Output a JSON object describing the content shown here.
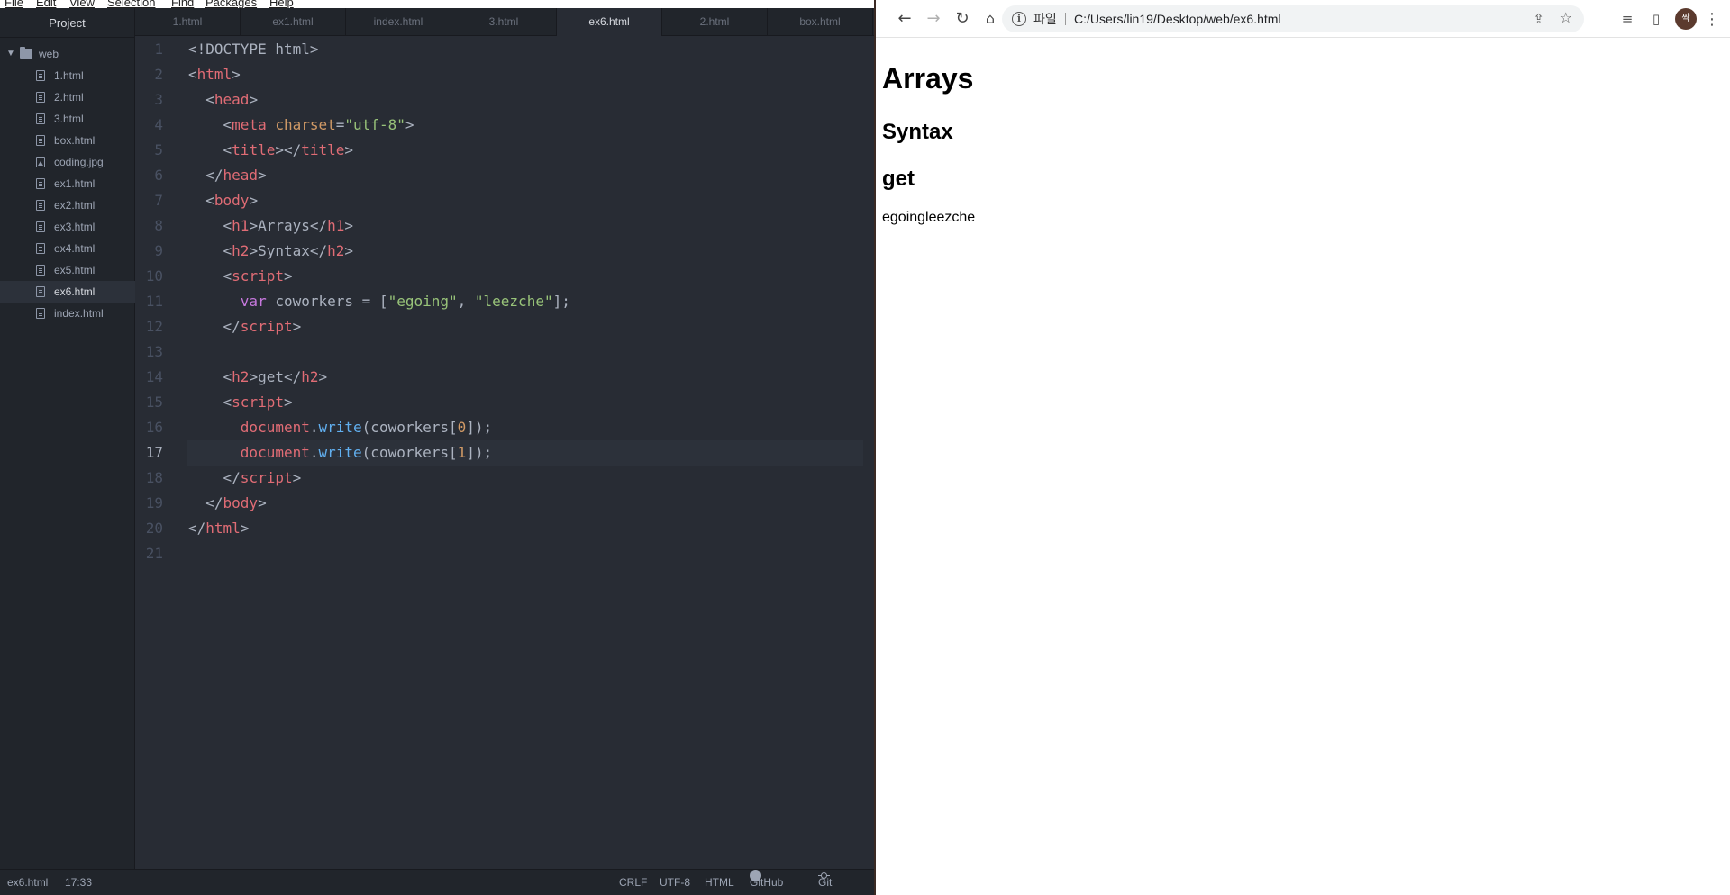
{
  "editor": {
    "menu": [
      "File",
      "Edit",
      "View",
      "Selection",
      "Find",
      "Packages",
      "Help"
    ],
    "tree": {
      "header": "Project",
      "folder": "web",
      "files": [
        {
          "name": "1.html",
          "type": "file"
        },
        {
          "name": "2.html",
          "type": "file"
        },
        {
          "name": "3.html",
          "type": "file"
        },
        {
          "name": "box.html",
          "type": "file"
        },
        {
          "name": "coding.jpg",
          "type": "image"
        },
        {
          "name": "ex1.html",
          "type": "file"
        },
        {
          "name": "ex2.html",
          "type": "file"
        },
        {
          "name": "ex3.html",
          "type": "file"
        },
        {
          "name": "ex4.html",
          "type": "file"
        },
        {
          "name": "ex5.html",
          "type": "file"
        },
        {
          "name": "ex6.html",
          "type": "file",
          "selected": true
        },
        {
          "name": "index.html",
          "type": "file"
        }
      ]
    },
    "tabs": [
      {
        "label": "1.html"
      },
      {
        "label": "ex1.html"
      },
      {
        "label": "index.html"
      },
      {
        "label": "3.html"
      },
      {
        "label": "ex6.html",
        "active": true
      },
      {
        "label": "2.html"
      },
      {
        "label": "box.html"
      }
    ],
    "current_line": 17,
    "code_lines": [
      [
        [
          "p",
          "<!DOCTYPE html>"
        ]
      ],
      [
        [
          "p",
          "<"
        ],
        [
          "t",
          "html"
        ],
        [
          "p",
          ">"
        ]
      ],
      [
        [
          "p",
          "  <"
        ],
        [
          "t",
          "head"
        ],
        [
          "p",
          ">"
        ]
      ],
      [
        [
          "p",
          "    <"
        ],
        [
          "t",
          "meta"
        ],
        [
          "p",
          " "
        ],
        [
          "a",
          "charset"
        ],
        [
          "p",
          "="
        ],
        [
          "s",
          "\"utf-8\""
        ],
        [
          "p",
          ">"
        ]
      ],
      [
        [
          "p",
          "    <"
        ],
        [
          "t",
          "title"
        ],
        [
          "p",
          "></"
        ],
        [
          "t",
          "title"
        ],
        [
          "p",
          ">"
        ]
      ],
      [
        [
          "p",
          "  </"
        ],
        [
          "t",
          "head"
        ],
        [
          "p",
          ">"
        ]
      ],
      [
        [
          "p",
          "  <"
        ],
        [
          "t",
          "body"
        ],
        [
          "p",
          ">"
        ]
      ],
      [
        [
          "p",
          "    <"
        ],
        [
          "t",
          "h1"
        ],
        [
          "p",
          ">Arrays</"
        ],
        [
          "t",
          "h1"
        ],
        [
          "p",
          ">"
        ]
      ],
      [
        [
          "p",
          "    <"
        ],
        [
          "t",
          "h2"
        ],
        [
          "p",
          ">Syntax</"
        ],
        [
          "t",
          "h2"
        ],
        [
          "p",
          ">"
        ]
      ],
      [
        [
          "p",
          "    <"
        ],
        [
          "t",
          "script"
        ],
        [
          "p",
          ">"
        ]
      ],
      [
        [
          "p",
          "      "
        ],
        [
          "k",
          "var"
        ],
        [
          "p",
          " coworkers = ["
        ],
        [
          "s",
          "\"egoing\""
        ],
        [
          "p",
          ", "
        ],
        [
          "s",
          "\"leezche\""
        ],
        [
          "p",
          "];"
        ]
      ],
      [
        [
          "p",
          "    </"
        ],
        [
          "t",
          "script"
        ],
        [
          "p",
          ">"
        ]
      ],
      [
        [
          "p",
          ""
        ]
      ],
      [
        [
          "p",
          "    <"
        ],
        [
          "t",
          "h2"
        ],
        [
          "p",
          ">get</"
        ],
        [
          "t",
          "h2"
        ],
        [
          "p",
          ">"
        ]
      ],
      [
        [
          "p",
          "    <"
        ],
        [
          "t",
          "script"
        ],
        [
          "p",
          ">"
        ]
      ],
      [
        [
          "p",
          "      "
        ],
        [
          "v",
          "document"
        ],
        [
          "p",
          "."
        ],
        [
          "f",
          "write"
        ],
        [
          "p",
          "(coworkers["
        ],
        [
          "n",
          "0"
        ],
        [
          "p",
          "]);"
        ]
      ],
      [
        [
          "p",
          "      "
        ],
        [
          "v",
          "document"
        ],
        [
          "p",
          "."
        ],
        [
          "f",
          "write"
        ],
        [
          "p",
          "(coworkers["
        ],
        [
          "n",
          "1"
        ],
        [
          "p",
          "]);"
        ]
      ],
      [
        [
          "p",
          "    </"
        ],
        [
          "t",
          "script"
        ],
        [
          "p",
          ">"
        ]
      ],
      [
        [
          "p",
          "  </"
        ],
        [
          "t",
          "body"
        ],
        [
          "p",
          ">"
        ]
      ],
      [
        [
          "p",
          "</"
        ],
        [
          "t",
          "html"
        ],
        [
          "p",
          ">"
        ]
      ],
      [
        [
          "p",
          ""
        ]
      ]
    ],
    "status": {
      "file": "ex6.html",
      "cursor": "17:33",
      "line_ending": "CRLF",
      "encoding": "UTF-8",
      "grammar": "HTML",
      "github": "GitHub",
      "git": "Git (0)"
    }
  },
  "browser": {
    "scheme_label": "파일",
    "url": "C:/Users/lin19/Desktop/web/ex6.html",
    "avatar_initial": "짝",
    "nav_icons": [
      "back-arrow-icon",
      "forward-arrow-icon",
      "reload-icon",
      "home-icon"
    ],
    "page": {
      "h1": "Arrays",
      "h2_syntax": "Syntax",
      "h2_get": "get",
      "output": "egoingleezche"
    }
  },
  "colors": {
    "editor_bg": "#282c34",
    "sidebar_bg": "#21252b",
    "tag": "#e06c75",
    "attribute": "#d19a66",
    "string": "#98c379",
    "keyword": "#c678dd",
    "function": "#61afef"
  }
}
